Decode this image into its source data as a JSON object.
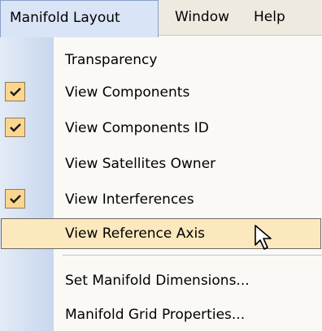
{
  "menubar": {
    "items": [
      {
        "label": "Manifold Layout"
      },
      {
        "label": "Window"
      },
      {
        "label": "Help"
      }
    ]
  },
  "menu": {
    "items": [
      {
        "label": "Transparency",
        "checked": false
      },
      {
        "label": "View Components",
        "checked": true
      },
      {
        "label": "View Components ID",
        "checked": true
      },
      {
        "label": "View Satellites Owner",
        "checked": false
      },
      {
        "label": "View Interferences",
        "checked": true
      },
      {
        "label": "View Reference Axis",
        "checked": false,
        "highlighted": true
      },
      {
        "label": "Set Manifold Dimensions...",
        "checked": false
      },
      {
        "label": "Manifold Grid Properties...",
        "checked": false
      }
    ]
  },
  "icons": {
    "check": "checkmark-icon",
    "cursor": "mouse-pointer-icon"
  },
  "colors": {
    "checkbox_bg": "#fbd68e",
    "checkmark": "#1a1a1a",
    "highlight_bg": "#fbe8bd",
    "gutter": "#c7d7ee",
    "menubar_active": "#d9e4f6"
  }
}
